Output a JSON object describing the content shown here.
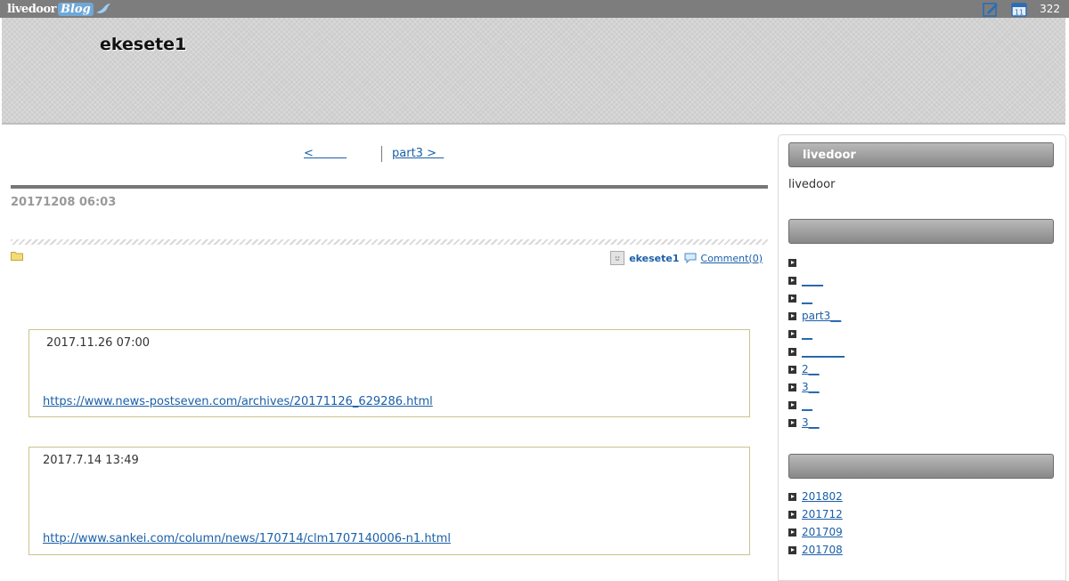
{
  "topbar": {
    "brand_text": "livedoor",
    "brand_blog": "Blog",
    "calendar_day": "11",
    "count": "322"
  },
  "header": {
    "title": "ekesete1"
  },
  "pager": {
    "prev_label": "<         ",
    "next_label": "part3 >  "
  },
  "entry": {
    "date": "20171208 06:03",
    "author": "ekesete1",
    "comment_label": "Comment(0)",
    "quotes": [
      {
        "date": "2017.11.26 07:00",
        "link": "https://www.news-postseven.com/archives/20171126_629286.html"
      },
      {
        "date": "2017.7.14 13:49",
        "link": "http://www.sankei.com/column/news/170714/clm1707140006-n1.html"
      }
    ]
  },
  "sidebar": {
    "section1_title": "livedoor",
    "section1_text": "livedoor",
    "section2_title": "",
    "section3_title": "",
    "recent_items": [
      {
        "label": ""
      },
      {
        "label": "____"
      },
      {
        "label": "__"
      },
      {
        "label": "part3__"
      },
      {
        "label": "__"
      },
      {
        "label": "________"
      },
      {
        "label": "2__"
      },
      {
        "label": "3__"
      },
      {
        "label": "__"
      },
      {
        "label": "3__"
      }
    ],
    "archives": [
      {
        "label": "201802"
      },
      {
        "label": "201712"
      },
      {
        "label": "201709"
      },
      {
        "label": "201708"
      }
    ]
  }
}
